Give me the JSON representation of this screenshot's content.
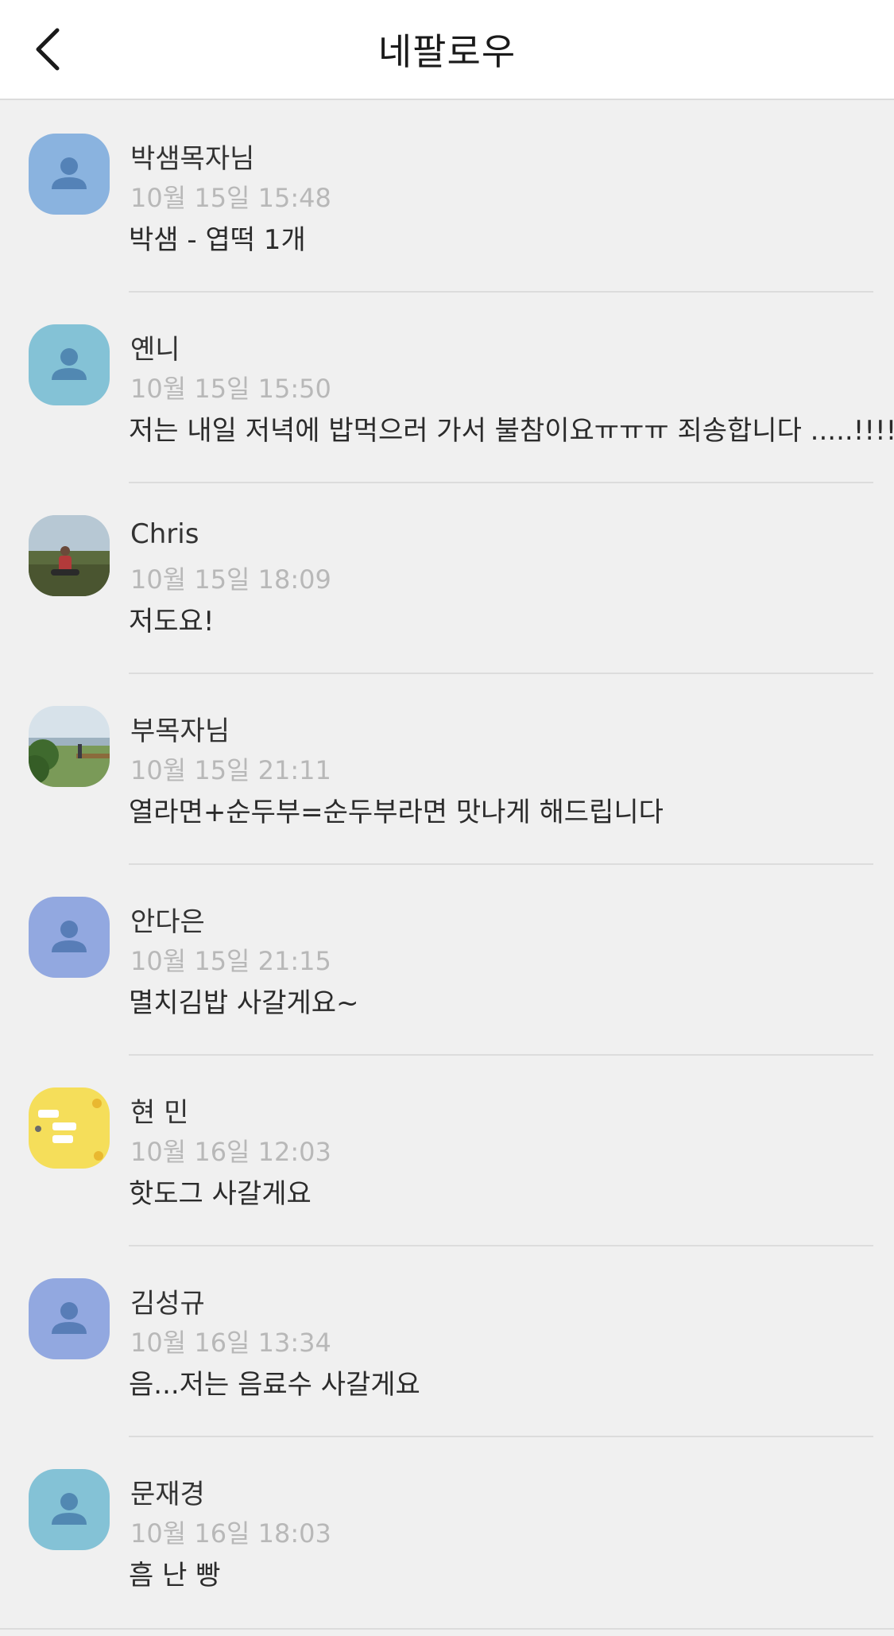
{
  "header": {
    "title": "네팔로우",
    "back_icon": "chevron-left-icon"
  },
  "comments": [
    {
      "name": "박샘목자님",
      "time": "10월 15일 15:48",
      "message": "박샘 - 엽떡 1개",
      "avatar": "default-avatar-icon",
      "avatar_color": "#8ab3df"
    },
    {
      "name": "옌니",
      "time": "10월 15일 15:50",
      "message": "저는 내일 저녁에 밥먹으러 가서 불참이요ㅠㅠㅠ 죄송합니다 .....!!!!!!",
      "avatar": "default-avatar-icon",
      "avatar_color": "#84c2d6"
    },
    {
      "name": "Chris",
      "time": "10월 15일 18:09",
      "message": "저도요!",
      "avatar": "photo-avatar-person-outdoors",
      "avatar_color": "#7a8f9a"
    },
    {
      "name": "부목자님",
      "time": "10월 15일 21:11",
      "message": "열라면+순두부=순두부라면 맛나게 해드립니다",
      "avatar": "photo-avatar-landscape",
      "avatar_color": "#6f8f5a"
    },
    {
      "name": "안다은",
      "time": "10월 15일 21:15",
      "message": "멸치김밥 사갈게요~",
      "avatar": "default-avatar-icon",
      "avatar_color": "#92a8e0"
    },
    {
      "name": "현 민",
      "time": "10월 16일 12:03",
      "message": "핫도그 사갈게요",
      "avatar": "photo-avatar-yellow-cartoon",
      "avatar_color": "#f5de5a"
    },
    {
      "name": "김성규",
      "time": "10월 16일 13:34",
      "message": "음...저는 음료수 사갈게요",
      "avatar": "default-avatar-icon",
      "avatar_color": "#92a8e0"
    },
    {
      "name": "문재경",
      "time": "10월 16일 18:03",
      "message": "흠 난 빵",
      "avatar": "default-avatar-icon",
      "avatar_color": "#84c2d6"
    }
  ]
}
